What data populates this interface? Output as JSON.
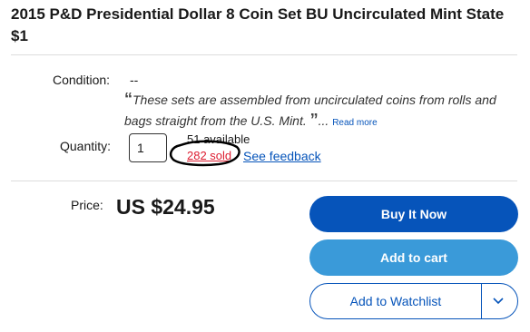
{
  "listing": {
    "title": "2015 P&D Presidential Dollar 8 Coin Set BU Uncirculated Mint State $1"
  },
  "condition": {
    "label": "Condition:",
    "value": "--",
    "open_quote": "“",
    "description": "These sets are assembled from uncirculated coins from rolls and bags straight from the U.S. Mint.",
    "close_quote": "”",
    "ellipsis": "...",
    "read_more": "Read more"
  },
  "quantity": {
    "label": "Quantity:",
    "value": "1",
    "available": "51 available",
    "sold": "282 sold",
    "see_feedback": "See feedback"
  },
  "price": {
    "label": "Price:",
    "value": "US $24.95"
  },
  "actions": {
    "buy_now": "Buy It Now",
    "add_to_cart": "Add to cart",
    "add_to_watchlist": "Add to Watchlist"
  },
  "colors": {
    "primary": "#0654ba",
    "cart": "#3a9ad9",
    "sold": "#dd1e31"
  }
}
